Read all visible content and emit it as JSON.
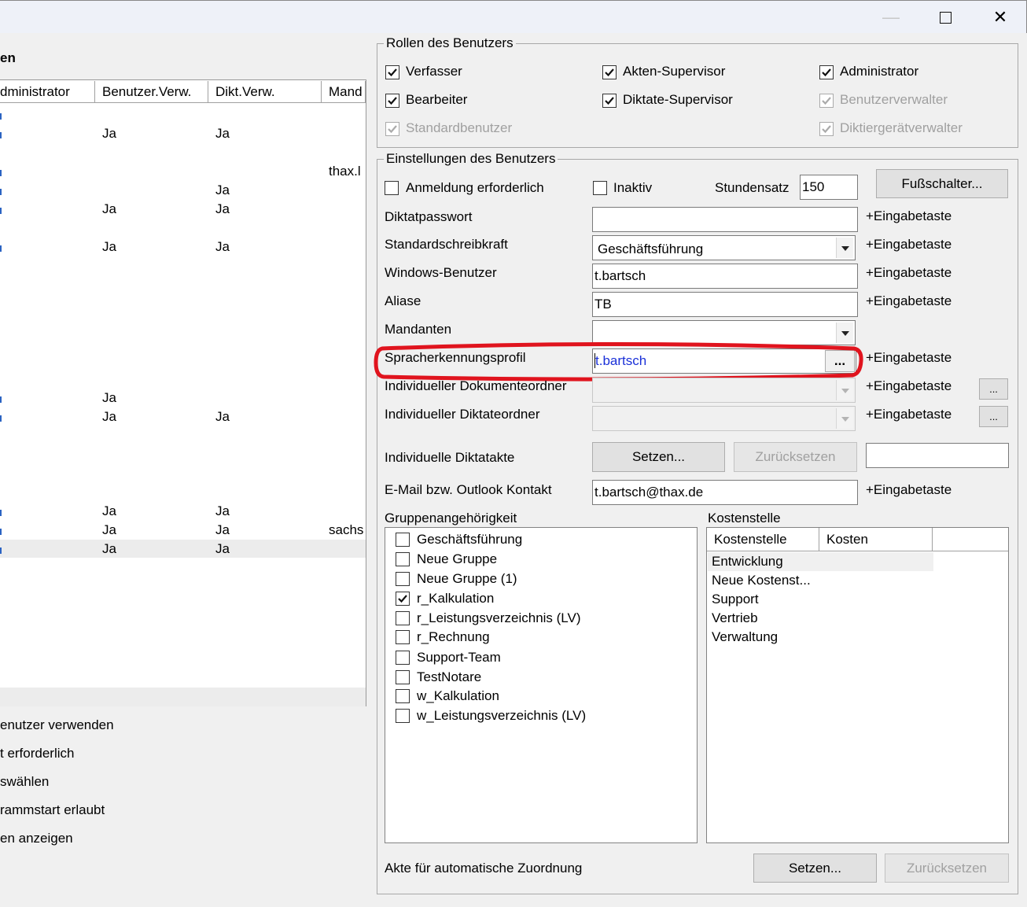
{
  "window": {
    "min_glyph": "—",
    "close_glyph": "✕"
  },
  "left": {
    "heading": "en",
    "columns": [
      "dministrator",
      "Benutzer.Verw.",
      "Dikt.Verw.",
      "Mand"
    ],
    "rows": [
      {
        "benutzer": "",
        "dikt": "",
        "mand": ""
      },
      {
        "benutzer": "Ja",
        "dikt": "Ja",
        "mand": ""
      },
      {
        "benutzer": "",
        "dikt": "",
        "mand": "thax.l"
      },
      {
        "benutzer": "",
        "dikt": "Ja",
        "mand": ""
      },
      {
        "benutzer": "Ja",
        "dikt": "Ja",
        "mand": ""
      },
      {
        "benutzer": "Ja",
        "dikt": "Ja",
        "mand": ""
      },
      {
        "benutzer": "Ja",
        "dikt": "",
        "mand": ""
      },
      {
        "benutzer": "Ja",
        "dikt": "Ja",
        "mand": ""
      },
      {
        "benutzer": "Ja",
        "dikt": "Ja",
        "mand": ""
      },
      {
        "benutzer": "Ja",
        "dikt": "Ja",
        "mand": "sachs"
      },
      {
        "benutzer": "Ja",
        "dikt": "Ja",
        "mand": ""
      }
    ],
    "options": [
      "enutzer verwenden",
      "t erforderlich",
      "swählen",
      "rammstart erlaubt",
      "en anzeigen"
    ]
  },
  "roles": {
    "title": "Rollen des Benutzers",
    "items": [
      {
        "label": "Verfasser",
        "checked": true,
        "disabled": false
      },
      {
        "label": "Akten-Supervisor",
        "checked": true,
        "disabled": false
      },
      {
        "label": "Administrator",
        "checked": true,
        "disabled": false
      },
      {
        "label": "Bearbeiter",
        "checked": true,
        "disabled": false
      },
      {
        "label": "Diktate-Supervisor",
        "checked": true,
        "disabled": false
      },
      {
        "label": "Benutzerverwalter",
        "checked": true,
        "disabled": true
      },
      {
        "label": "Standardbenutzer",
        "checked": true,
        "disabled": true
      },
      {
        "label": "Diktiergerätverwalter",
        "checked": true,
        "disabled": true
      }
    ]
  },
  "settings": {
    "title": "Einstellungen des Benutzers",
    "login_required": "Anmeldung erforderlich",
    "inactive": "Inaktiv",
    "rate_label": "Stundensatz",
    "rate_value": "150",
    "footswitch_button": "Fußschalter...",
    "enter_hint": "+Eingabetaste",
    "dictation_password_label": "Diktatpasswort",
    "dictation_password_value": "",
    "typist_label": "Standardschreibkraft",
    "typist_value": "Geschäftsführung",
    "windows_user_label": "Windows-Benutzer",
    "windows_user_value": "t.bartsch",
    "alias_label": "Aliase",
    "alias_value": "TB",
    "clients_label": "Mandanten",
    "clients_value": "",
    "speech_profile_label": "Spracherkennungsprofil",
    "speech_profile_value": "t.bartsch",
    "browse_label": "...",
    "doc_folder_label": "Individueller Dokumenteordner",
    "dict_folder_label": "Individueller Diktateordner",
    "dict_files_label": "Individuelle Diktatakte",
    "set_button": "Setzen...",
    "reset_button": "Zurücksetzen",
    "email_label": "E-Mail bzw. Outlook Kontakt",
    "email_value": "t.bartsch@thax.de",
    "groups_label": "Gruppenangehörigkeit",
    "groups": [
      {
        "label": "Geschäftsführung",
        "checked": false
      },
      {
        "label": "Neue Gruppe",
        "checked": false
      },
      {
        "label": "Neue Gruppe (1)",
        "checked": false
      },
      {
        "label": "r_Kalkulation",
        "checked": true
      },
      {
        "label": "r_Leistungsverzeichnis (LV)",
        "checked": false
      },
      {
        "label": "r_Rechnung",
        "checked": false
      },
      {
        "label": "Support-Team",
        "checked": false
      },
      {
        "label": "TestNotare",
        "checked": false
      },
      {
        "label": "w_Kalkulation",
        "checked": false
      },
      {
        "label": "w_Leistungsverzeichnis (LV)",
        "checked": false
      }
    ],
    "cost_label": "Kostenstelle",
    "cost_columns": [
      "Kostenstelle",
      "Kosten"
    ],
    "cost_items": [
      "Entwicklung",
      "Neue Kostenst...",
      "Support",
      "Vertrieb",
      "Verwaltung"
    ],
    "auto_assign_label": "Akte für automatische Zuordnung",
    "auto_set_button": "Setzen...",
    "auto_reset_button": "Zurücksetzen"
  },
  "highlight_color": "#e0141e"
}
